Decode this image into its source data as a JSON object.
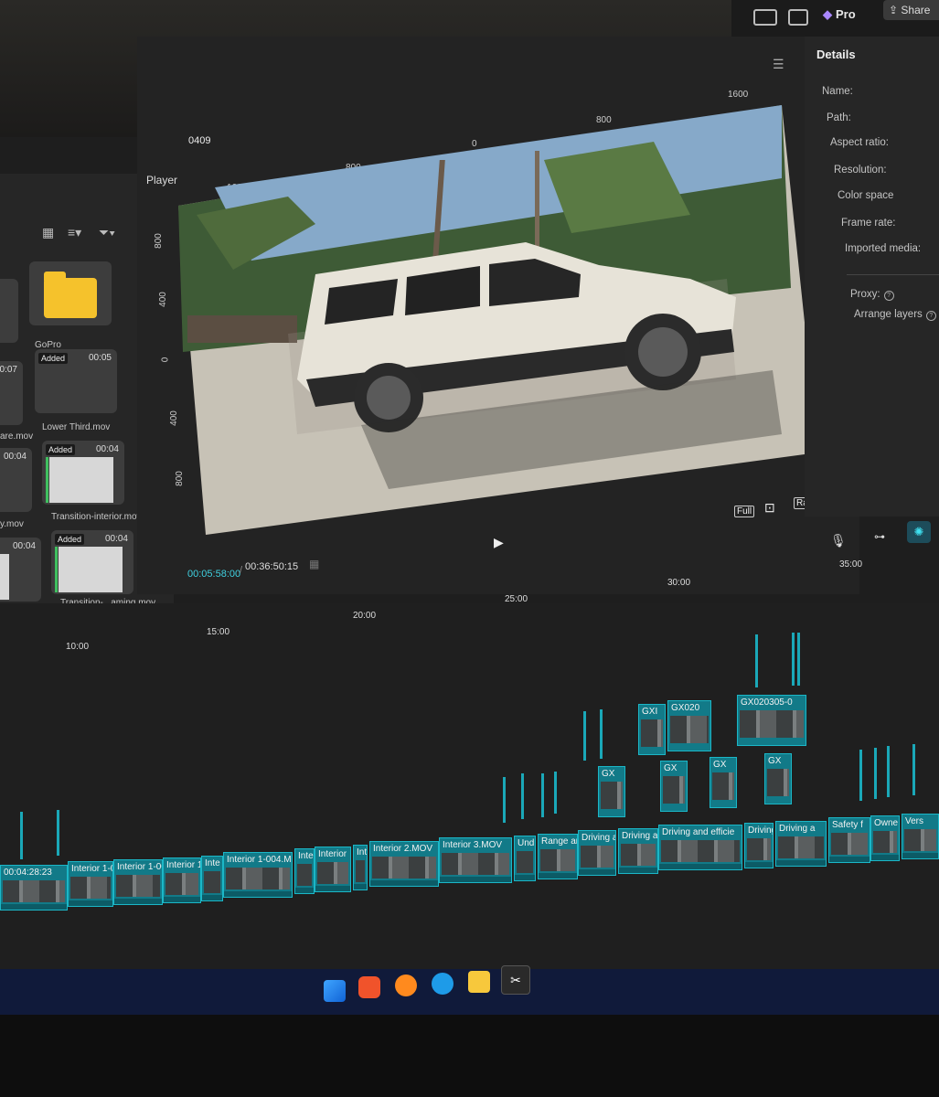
{
  "header": {
    "pro_label": "Pro",
    "share_label": "Share"
  },
  "media": {
    "items": [
      {
        "name": "GoPro",
        "duration": "",
        "added": ""
      },
      {
        "name": "are.mov",
        "duration": "00:07",
        "added": ""
      },
      {
        "name": "Lower Third.mov",
        "duration": "00:05",
        "added": "Added"
      },
      {
        "name": "y.mov",
        "duration": "00:04",
        "added": ""
      },
      {
        "name": "Transition-interior.mov",
        "duration": "00:04",
        "added": "Added"
      },
      {
        "name": "",
        "duration": "00:04",
        "added": ""
      },
      {
        "name": "Transition-...aming.mov",
        "duration": "00:04",
        "added": "Added"
      }
    ]
  },
  "player": {
    "title": "Player",
    "frame_label": "0409",
    "ruler_top": [
      "1600",
      "800",
      "0",
      "800",
      "1600"
    ],
    "ruler_left": [
      "800",
      "400",
      "0",
      "400",
      "800"
    ],
    "full_label": "Full",
    "ratio_label": "Ratio",
    "current_time": "00:05:58:00",
    "total_time": "00:36:50:15"
  },
  "details": {
    "title": "Details",
    "labels": [
      "Name:",
      "Path:",
      "Aspect ratio:",
      "Resolution:",
      "Color space",
      "Frame rate:",
      "Imported media:"
    ],
    "proxy_label": "Proxy:",
    "arrange_label": "Arrange layers"
  },
  "timeline": {
    "ticks": [
      "10:00",
      "15:00",
      "20:00",
      "25:00",
      "30:00",
      "35:00"
    ],
    "clips_upper": [
      "GXI",
      "GX020",
      "GX020305-0"
    ],
    "clips_main": [
      {
        "label": "00:04:28:23"
      },
      {
        "label": "Interior 1-0"
      },
      {
        "label": "Interior 1-004"
      },
      {
        "label": "Interior 1-"
      },
      {
        "label": "Inte"
      },
      {
        "label": "Interior 1-004.M"
      },
      {
        "label": "Inte"
      },
      {
        "label": "Interior"
      },
      {
        "label": "Inte"
      },
      {
        "label": "Interior 2.MOV"
      },
      {
        "label": "Interior 3.MOV"
      },
      {
        "label": "Und"
      },
      {
        "label": "Range an"
      },
      {
        "label": "Driving a"
      },
      {
        "label": "Driving a"
      },
      {
        "label": "Driving and efficie"
      },
      {
        "label": "Driving"
      },
      {
        "label": "Driving a"
      },
      {
        "label": "Safety f"
      },
      {
        "label": "Owne"
      },
      {
        "label": "Vers"
      }
    ],
    "clips_mid": [
      "GX",
      "GX",
      "GX",
      "GX"
    ]
  },
  "colors": {
    "accent": "#1bb7c7",
    "folder": "#f5c22c",
    "current_time": "#3fd0e0"
  }
}
